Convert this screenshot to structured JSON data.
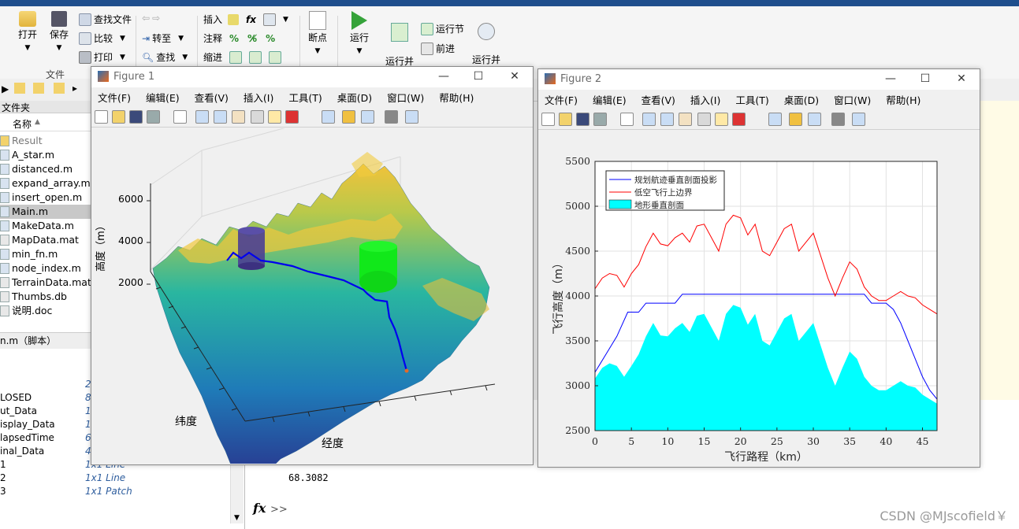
{
  "ribbon": {
    "file_section": "文件",
    "open": "打开",
    "save": "保存",
    "find_files": "查找文件",
    "compare": "比较",
    "print": "打印",
    "goto": "转至",
    "find": "查找",
    "insert": "插入",
    "comment": "注释",
    "indent": "缩进",
    "fx": "fx",
    "breakpoint": "断点",
    "run": "运行",
    "run_advance": "运行并\n前进",
    "run_section": "运行节",
    "advance": "前进",
    "run_time": "运行并\n计时"
  },
  "current_folder": {
    "header": "文件夹",
    "name_col": "名称",
    "files": [
      "Result",
      "A_star.m",
      "distanced.m",
      "expand_array.m",
      "insert_open.m",
      "Main.m",
      "MakeData.m",
      "MapData.mat",
      "min_fn.m",
      "node_index.m",
      "TerrainData.mat",
      "Thumbs.db",
      "说明.doc"
    ],
    "selected": "Main.m",
    "details": "n.m（脚本）"
  },
  "workspace": {
    "header": "区",
    "rows": [
      {
        "name": "",
        "value": "2"
      },
      {
        "name": "LOSED",
        "value": "8"
      },
      {
        "name": "ut_Data",
        "value": "1"
      },
      {
        "name": "isplay_Data",
        "value": "1"
      },
      {
        "name": "lapsedTime",
        "value": "6"
      },
      {
        "name": "inal_Data",
        "value": "450x450 double"
      },
      {
        "name": "1",
        "value": "1x1 Line"
      },
      {
        "name": "2",
        "value": "1x1 Line"
      },
      {
        "name": "3",
        "value": "1x1 Patch"
      }
    ]
  },
  "command_window": {
    "output": "68.3082",
    "prompt": ">>",
    "fx": "fx"
  },
  "figure1": {
    "title": "Figure 1",
    "menus": [
      "文件(F)",
      "编辑(E)",
      "查看(V)",
      "插入(I)",
      "工具(T)",
      "桌面(D)",
      "窗口(W)",
      "帮助(H)"
    ],
    "zlabel": "高度（m）",
    "xlabel": "经度",
    "ylabel": "纬度",
    "zticks": [
      "6000",
      "4000",
      "2000"
    ]
  },
  "figure2": {
    "title": "Figure 2",
    "menus": [
      "文件(F)",
      "编辑(E)",
      "查看(V)",
      "插入(I)",
      "工具(T)",
      "桌面(D)",
      "窗口(W)",
      "帮助(H)"
    ]
  },
  "chart_data": {
    "type": "line",
    "xlabel": "飞行路程（km）",
    "ylabel": "飞行高度（m）",
    "xlim": [
      0,
      47
    ],
    "ylim": [
      2500,
      5500
    ],
    "xticks": [
      0,
      5,
      10,
      15,
      20,
      25,
      30,
      35,
      40,
      45
    ],
    "yticks": [
      2500,
      3000,
      3500,
      4000,
      4500,
      5000,
      5500
    ],
    "grid": true,
    "legend_position": "top-left",
    "series": [
      {
        "name": "规划航迹垂直剖面投影",
        "color": "#0000ff",
        "type": "line",
        "x": [
          0,
          1.5,
          3,
          4.5,
          6,
          7,
          9,
          11,
          12,
          14,
          16,
          18,
          20,
          22,
          24,
          26,
          28,
          30,
          32,
          34,
          35,
          36,
          37,
          38,
          39,
          40,
          41,
          42,
          43,
          44,
          45,
          46,
          47
        ],
        "y": [
          3150,
          3350,
          3550,
          3820,
          3820,
          3920,
          3920,
          3920,
          4020,
          4020,
          4020,
          4020,
          4020,
          4020,
          4020,
          4020,
          4020,
          4020,
          4020,
          4020,
          4020,
          4020,
          4020,
          3920,
          3920,
          3920,
          3850,
          3700,
          3500,
          3300,
          3100,
          2950,
          2850
        ]
      },
      {
        "name": "低空飞行上边界",
        "color": "#ff0000",
        "type": "line",
        "x": [
          0,
          1,
          2,
          3,
          4,
          5,
          6,
          7,
          8,
          9,
          10,
          11,
          12,
          13,
          14,
          15,
          16,
          17,
          18,
          19,
          20,
          21,
          22,
          23,
          24,
          25,
          26,
          27,
          28,
          29,
          30,
          31,
          32,
          33,
          34,
          35,
          36,
          37,
          38,
          39,
          40,
          41,
          42,
          43,
          44,
          45,
          46,
          47
        ],
        "y": [
          4080,
          4200,
          4250,
          4230,
          4100,
          4250,
          4350,
          4550,
          4700,
          4580,
          4560,
          4650,
          4700,
          4600,
          4780,
          4800,
          4650,
          4500,
          4800,
          4900,
          4870,
          4680,
          4800,
          4500,
          4450,
          4600,
          4750,
          4800,
          4500,
          4600,
          4700,
          4450,
          4200,
          4000,
          4200,
          4380,
          4300,
          4100,
          4000,
          3950,
          3950,
          4000,
          4050,
          4000,
          3980,
          3900,
          3850,
          3800
        ]
      },
      {
        "name": "地形垂直剖面",
        "color": "#00ffff",
        "type": "area",
        "x": [
          0,
          1,
          2,
          3,
          4,
          5,
          6,
          7,
          8,
          9,
          10,
          11,
          12,
          13,
          14,
          15,
          16,
          17,
          18,
          19,
          20,
          21,
          22,
          23,
          24,
          25,
          26,
          27,
          28,
          29,
          30,
          31,
          32,
          33,
          34,
          35,
          36,
          37,
          38,
          39,
          40,
          41,
          42,
          43,
          44,
          45,
          46,
          47
        ],
        "y": [
          3080,
          3200,
          3250,
          3220,
          3100,
          3220,
          3350,
          3550,
          3700,
          3560,
          3550,
          3640,
          3700,
          3600,
          3780,
          3800,
          3650,
          3500,
          3800,
          3900,
          3870,
          3680,
          3800,
          3500,
          3450,
          3600,
          3750,
          3800,
          3500,
          3600,
          3700,
          3450,
          3200,
          3000,
          3200,
          3380,
          3300,
          3100,
          3000,
          2950,
          2950,
          3000,
          3050,
          3000,
          2980,
          2900,
          2850,
          2800
        ]
      }
    ]
  },
  "watermark": "CSDN @MJscofield￥"
}
